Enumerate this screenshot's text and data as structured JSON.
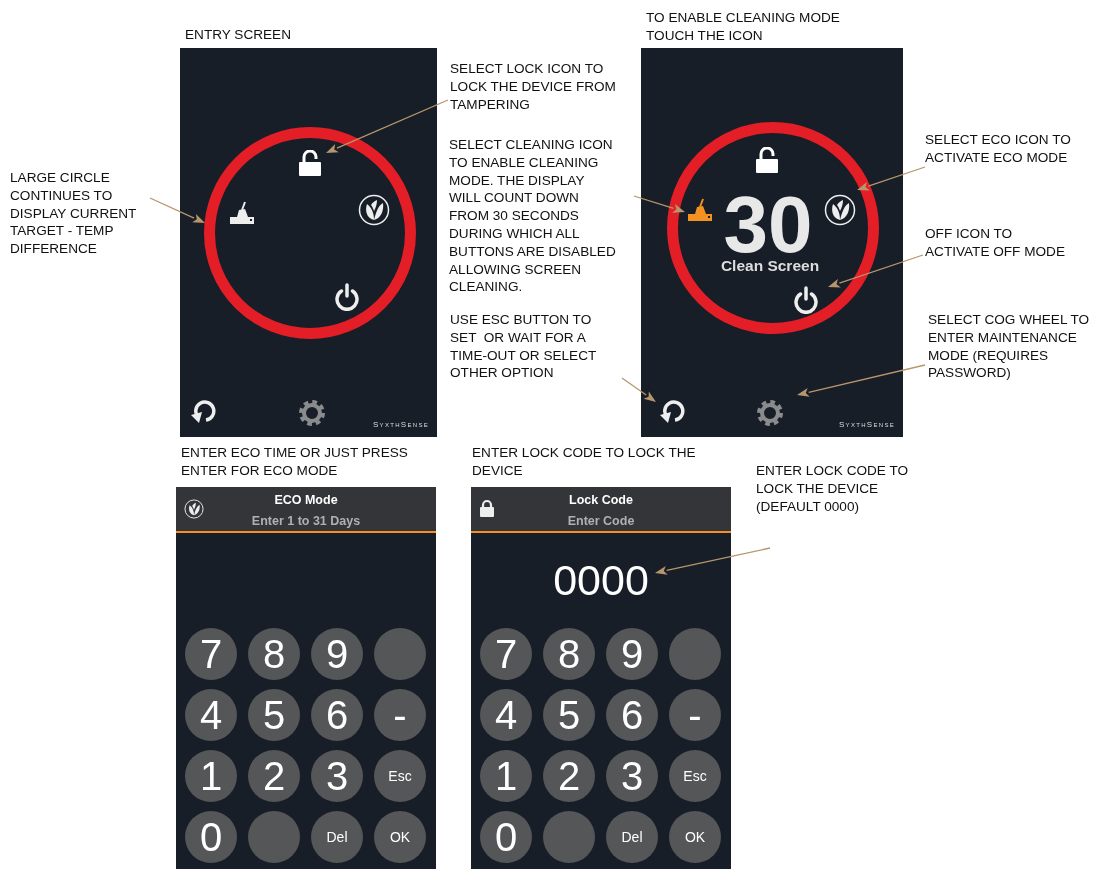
{
  "annotations": [
    {
      "lines": [
        "ENTRY SCREEN"
      ]
    },
    {
      "lines": [
        "SELECT LOCK ICON TO",
        "LOCK THE DEVICE FROM",
        "TAMPERING"
      ]
    },
    {
      "lines": [
        "LARGE CIRCLE",
        "CONTINUES TO",
        "DISPLAY CURRENT",
        "TARGET - TEMP",
        "DIFFERENCE"
      ]
    },
    {
      "lines": [
        "SELECT CLEANING ICON",
        "TO ENABLE CLEANING",
        "MODE. THE DISPLAY",
        "WILL COUNT DOWN",
        "FROM 30 SECONDS",
        "DURING WHICH ALL",
        "BUTTONS ARE DISABLED",
        "ALLOWING SCREEN",
        "CLEANING."
      ]
    },
    {
      "lines": [
        "USE ESC BUTTON TO",
        "SET  OR WAIT FOR A",
        "TIME-OUT OR SELECT",
        "OTHER OPTION"
      ]
    },
    {
      "lines": [
        "TO ENABLE CLEANING MODE",
        "TOUCH THE ICON"
      ]
    },
    {
      "lines": [
        "SELECT ECO ICON TO",
        "ACTIVATE ECO MODE"
      ]
    },
    {
      "lines": [
        "OFF ICON TO",
        "ACTIVATE OFF MODE"
      ]
    },
    {
      "lines": [
        "SELECT COG WHEEL TO",
        "ENTER MAINTENANCE",
        "MODE (REQUIRES",
        "PASSWORD)"
      ]
    },
    {
      "lines": [
        "ENTER ECO TIME OR JUST PRESS",
        "ENTER FOR ECO MODE"
      ]
    },
    {
      "lines": [
        "ENTER LOCK CODE TO LOCK THE",
        "DEVICE"
      ]
    },
    {
      "lines": [
        "ENTER LOCK CODE TO",
        "LOCK THE DEVICE",
        "(DEFAULT 0000)"
      ]
    }
  ],
  "screens": [
    {
      "kind": "home",
      "cleaning_active": false,
      "brand": "SyxthSense"
    },
    {
      "kind": "home",
      "cleaning_active": true,
      "countdown": "30",
      "message": "Clean Screen",
      "brand": "SyxthSense"
    },
    {
      "kind": "keypad",
      "title": "ECO Mode",
      "subtitle": "Enter 1 to 31 Days",
      "keys": [
        {
          "kind": "digit",
          "label": "7"
        },
        {
          "kind": "digit",
          "label": "8"
        },
        {
          "kind": "digit",
          "label": "9"
        },
        {
          "kind": "blank"
        },
        {
          "kind": "digit",
          "label": "4"
        },
        {
          "kind": "digit",
          "label": "5"
        },
        {
          "kind": "digit",
          "label": "6"
        },
        {
          "kind": "digit",
          "label": "-"
        },
        {
          "kind": "digit",
          "label": "1"
        },
        {
          "kind": "digit",
          "label": "2"
        },
        {
          "kind": "digit",
          "label": "3"
        },
        {
          "kind": "command",
          "label": "Esc"
        },
        {
          "kind": "digit",
          "label": "0"
        },
        {
          "kind": "blank"
        },
        {
          "kind": "command",
          "label": "Del"
        },
        {
          "kind": "command",
          "label": "OK"
        }
      ]
    },
    {
      "kind": "keypad",
      "title": "Lock Code",
      "subtitle": "Enter Code",
      "value": "0000",
      "keys": [
        {
          "kind": "digit",
          "label": "7"
        },
        {
          "kind": "digit",
          "label": "8"
        },
        {
          "kind": "digit",
          "label": "9"
        },
        {
          "kind": "blank"
        },
        {
          "kind": "digit",
          "label": "4"
        },
        {
          "kind": "digit",
          "label": "5"
        },
        {
          "kind": "digit",
          "label": "6"
        },
        {
          "kind": "digit",
          "label": "-"
        },
        {
          "kind": "digit",
          "label": "1"
        },
        {
          "kind": "digit",
          "label": "2"
        },
        {
          "kind": "digit",
          "label": "3"
        },
        {
          "kind": "command",
          "label": "Esc"
        },
        {
          "kind": "digit",
          "label": "0"
        },
        {
          "kind": "blank"
        },
        {
          "kind": "command",
          "label": "Del"
        },
        {
          "kind": "command",
          "label": "OK"
        }
      ]
    }
  ]
}
